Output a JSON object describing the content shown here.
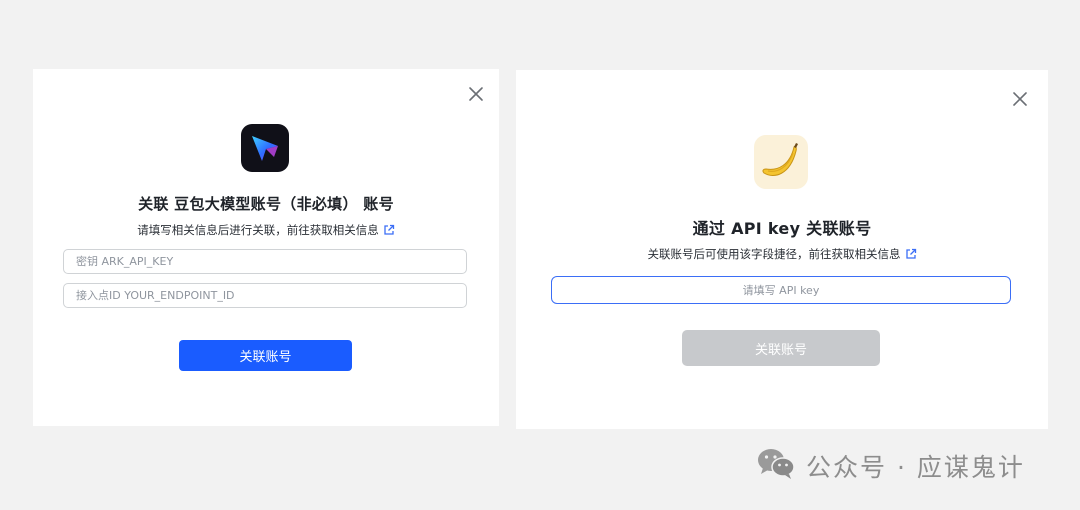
{
  "left_dialog": {
    "title": "关联 豆包大模型账号（非必填） 账号",
    "subtitle": "请填写相关信息后进行关联，前往获取相关信息",
    "api_key_field": {
      "placeholder": "密钥 ARK_API_KEY",
      "value": ""
    },
    "endpoint_field": {
      "placeholder": "接入点ID YOUR_ENDPOINT_ID",
      "value": ""
    },
    "submit_label": "关联账号",
    "brand_color": "#1a5cff"
  },
  "right_dialog": {
    "title": "通过 API key 关联账号",
    "subtitle": "关联账号后可使用该字段捷径，前往获取相关信息",
    "api_key_field": {
      "placeholder": "请填写 API key",
      "value": ""
    },
    "submit_label": "关联账号",
    "submit_state": "disabled",
    "focus_color": "#3b6ef6"
  },
  "watermark": {
    "text": "公众号 · 应谋鬼计"
  },
  "icons": {
    "close": "close-icon",
    "external_link": "external-link-icon",
    "doubao_logo": "doubao-logo",
    "banana_logo": "banana-logo",
    "wechat": "wechat-icon"
  }
}
